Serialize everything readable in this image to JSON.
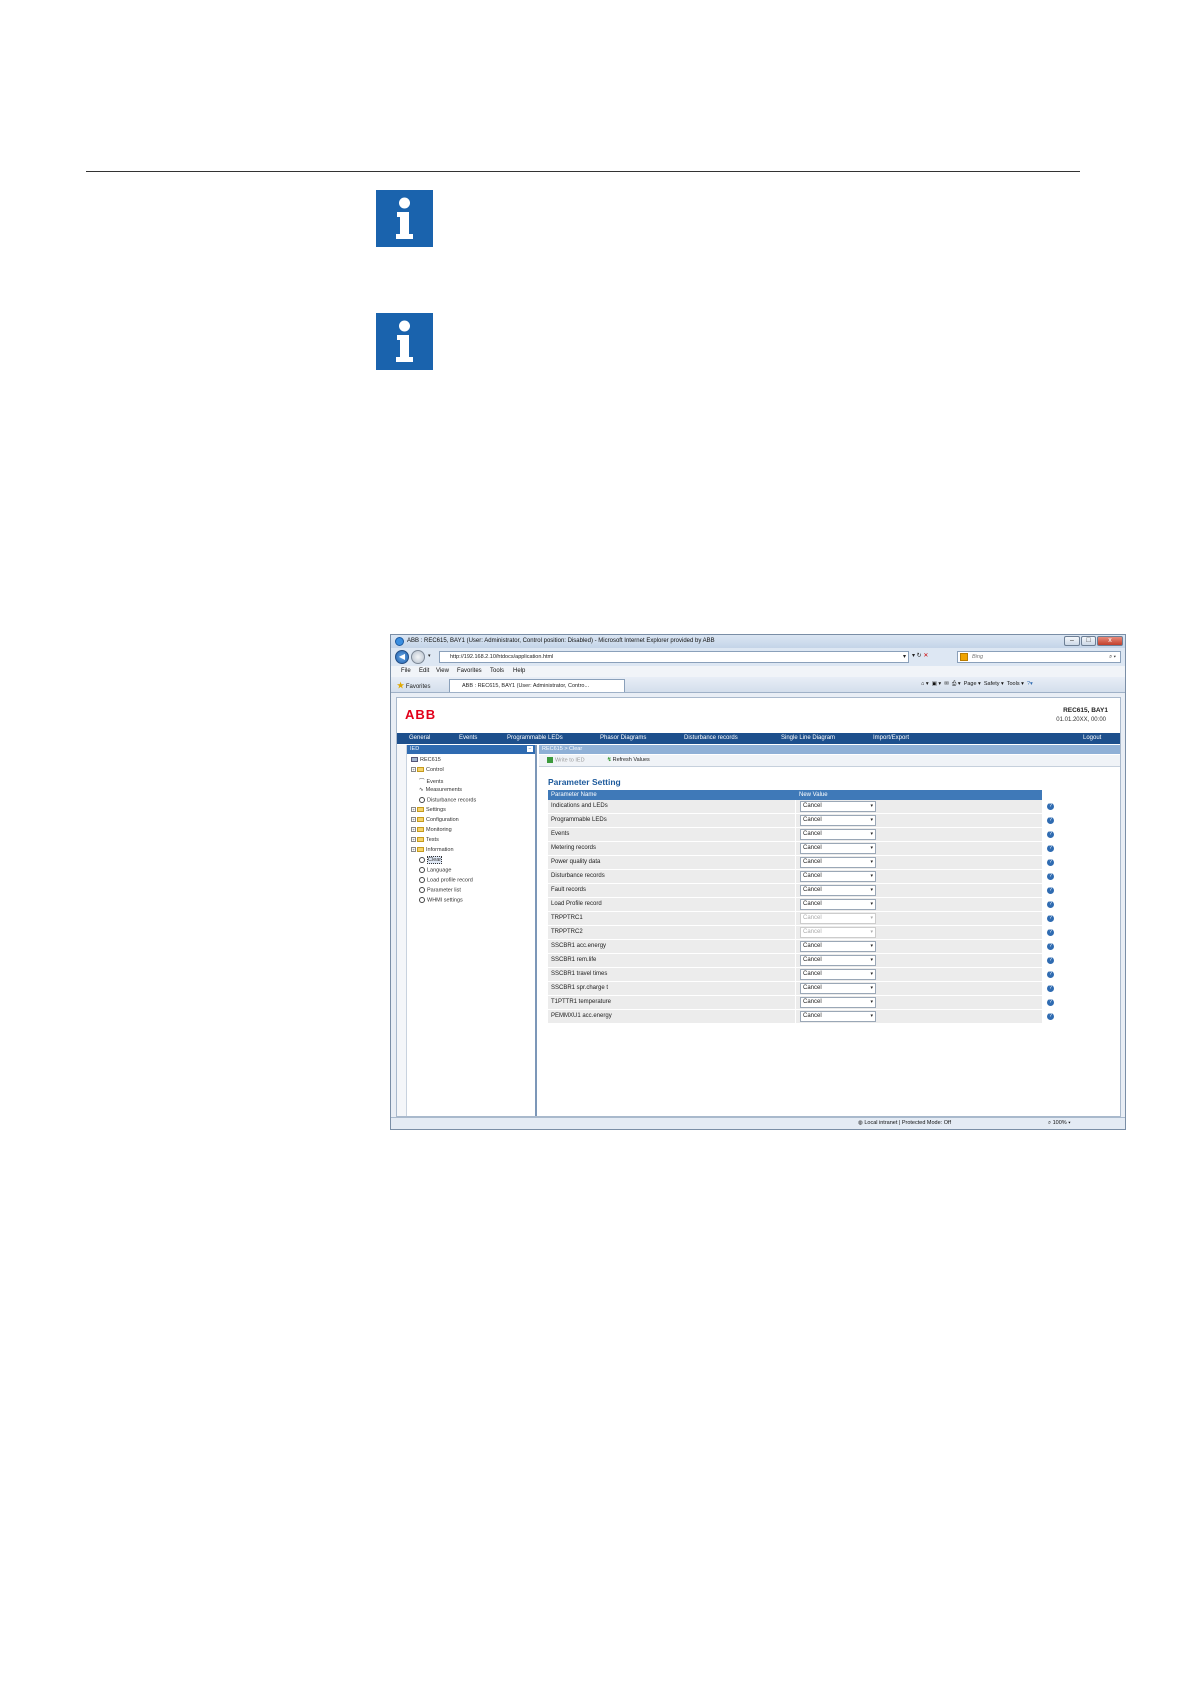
{
  "screenshot": {
    "window_title": "ABB : REC615, BAY1 (User: Administrator, Control position: Disabled) - Microsoft Internet Explorer provided by ABB",
    "address": "http://192.168.2.10/htdocs/application.html",
    "search_placeholder": "Bing",
    "menu": [
      "File",
      "Edit",
      "View",
      "Favorites",
      "Tools",
      "Help"
    ],
    "favorites_label": "Favorites",
    "tab_label": "ABB : REC615, BAY1 (User: Administrator, Contro...",
    "command_bar": [
      "Page ▾",
      "Safety ▾",
      "Tools ▾"
    ],
    "logo": "ABB",
    "device_name": "REC615, BAY1",
    "device_date": "01.01.20XX, 00:00",
    "top_nav": [
      "General",
      "Events",
      "Programmable LEDs",
      "Phasor Diagrams",
      "Disturbance records",
      "Single Line Diagram",
      "Import/Export"
    ],
    "logout": "Logout",
    "tree_header": "IED",
    "tree": [
      {
        "label": "REC615",
        "kind": "root"
      },
      {
        "label": "Control",
        "kind": "folder"
      },
      {
        "label": "Events",
        "kind": "leaf"
      },
      {
        "label": "Measurements",
        "kind": "leaf"
      },
      {
        "label": "Disturbance records",
        "kind": "gear"
      },
      {
        "label": "Settings",
        "kind": "folder"
      },
      {
        "label": "Configuration",
        "kind": "folder"
      },
      {
        "label": "Monitoring",
        "kind": "folder"
      },
      {
        "label": "Tests",
        "kind": "folder"
      },
      {
        "label": "Information",
        "kind": "folder"
      },
      {
        "label": "Clear",
        "kind": "gear"
      },
      {
        "label": "Language",
        "kind": "gear"
      },
      {
        "label": "Load profile record",
        "kind": "gear"
      },
      {
        "label": "Parameter list",
        "kind": "gear"
      },
      {
        "label": "WHMI settings",
        "kind": "gear"
      }
    ],
    "breadcrumb": "REC615 > Clear",
    "write_button": "Write to IED",
    "refresh_button": "Refresh Values",
    "panel_title": "Parameter Setting",
    "col_param": "Parameter Name",
    "col_value": "New Value",
    "rows": [
      {
        "name": "Indications and LEDs",
        "value": "Cancel"
      },
      {
        "name": "Programmable LEDs",
        "value": "Cancel"
      },
      {
        "name": "Events",
        "value": "Cancel"
      },
      {
        "name": "Metering records",
        "value": "Cancel"
      },
      {
        "name": "Power quality data",
        "value": "Cancel"
      },
      {
        "name": "Disturbance records",
        "value": "Cancel"
      },
      {
        "name": "Fault records",
        "value": "Cancel"
      },
      {
        "name": "Load Profile record",
        "value": "Cancel"
      },
      {
        "name": "TRPPTRC1",
        "value": "Cancel",
        "disabled": true
      },
      {
        "name": "TRPPTRC2",
        "value": "Cancel",
        "disabled": true
      },
      {
        "name": "SSCBR1 acc.energy",
        "value": "Cancel"
      },
      {
        "name": "SSCBR1 rem.life",
        "value": "Cancel"
      },
      {
        "name": "SSCBR1 travel times",
        "value": "Cancel"
      },
      {
        "name": "SSCBR1 spr.charge t",
        "value": "Cancel"
      },
      {
        "name": "T1PTTR1 temperature",
        "value": "Cancel"
      },
      {
        "name": "PEMMXU1 acc.energy",
        "value": "Cancel"
      }
    ],
    "status_zone": "Local intranet | Protected Mode: Off",
    "zoom": "100%"
  },
  "colors": {
    "info_icon": "#1a63ad",
    "nav_bar": "#1d4f8c",
    "abb_red": "#e2001a"
  }
}
